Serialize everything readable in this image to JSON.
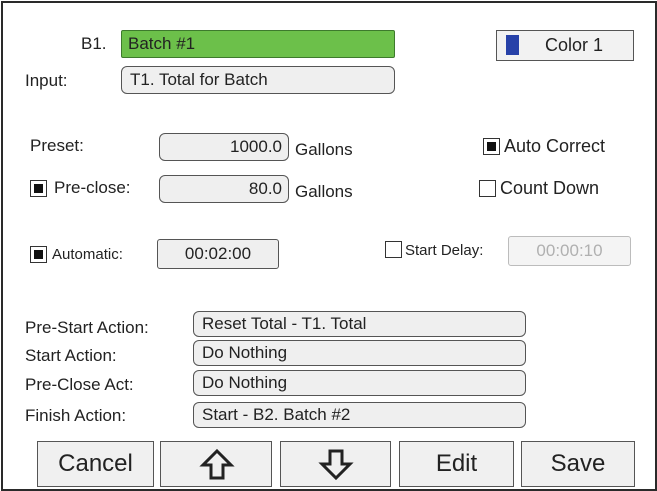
{
  "batch": {
    "id_label": "B1.",
    "name": "Batch #1",
    "color_label": "Color 1",
    "swatch_color": "#2741a8",
    "name_color": "#6cc04a"
  },
  "input": {
    "label": "Input:",
    "value": "T1. Total for Batch"
  },
  "preset": {
    "label": "Preset:",
    "value": "1000.0",
    "unit": "Gallons"
  },
  "preclose": {
    "label": "Pre-close:",
    "value": "80.0",
    "unit": "Gallons",
    "checked": true
  },
  "options": {
    "auto_correct": {
      "label": "Auto Correct",
      "checked": true
    },
    "count_down": {
      "label": "Count Down",
      "checked": false
    }
  },
  "automatic": {
    "label": "Automatic:",
    "value": "00:02:00",
    "checked": true
  },
  "start_delay": {
    "label": "Start Delay:",
    "value": "00:00:10",
    "checked": false
  },
  "actions": {
    "pre_start": {
      "label": "Pre-Start Action:",
      "value": "Reset Total - T1. Total"
    },
    "start": {
      "label": "Start Action:",
      "value": "Do Nothing"
    },
    "pre_close": {
      "label": "Pre-Close Act:",
      "value": "Do Nothing"
    },
    "finish": {
      "label": "Finish Action:",
      "value": "Start - B2. Batch #2"
    }
  },
  "buttons": {
    "cancel": "Cancel",
    "up_icon": "arrow-up-outline",
    "down_icon": "arrow-down-outline",
    "edit": "Edit",
    "save": "Save"
  }
}
